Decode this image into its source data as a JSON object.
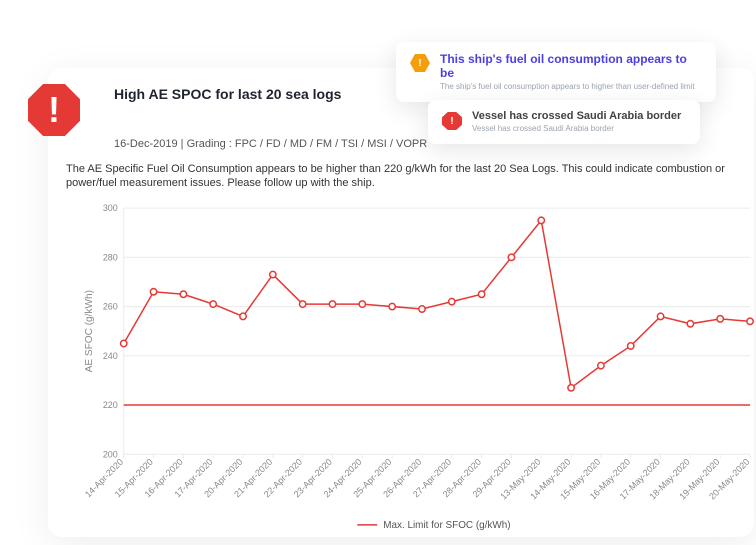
{
  "notifications": [
    {
      "icon": "warning-icon",
      "title": "This ship's fuel oil consumption appears to be",
      "subtitle": "The ship's fuel oil consumption appears to higher than user-defined limit"
    },
    {
      "icon": "alert-icon",
      "title": "Vessel has crossed Saudi Arabia border",
      "subtitle": "Vessel has crossed Saudi Arabia border"
    }
  ],
  "card": {
    "alert_symbol": "!",
    "title": "High AE SPOC for last 20 sea logs",
    "meta": "16-Dec-2019 | Grading : FPC / FD / MD / FM / TSI / MSI / VOPR",
    "description": "The AE Specific Fuel Oil Consumption appears to be higher than 220 g/kWh for the last 20 Sea Logs. This could indicate combustion or power/fuel measurement issues. Please follow up with the ship."
  },
  "chart_data": {
    "type": "line",
    "title": "",
    "xlabel": "",
    "ylabel": "AE SFOC (g/kWh)",
    "ylim": [
      200,
      300
    ],
    "yticks": [
      200,
      220,
      240,
      260,
      280,
      300
    ],
    "categories": [
      "14-Apr-2020",
      "15-Apr-2020",
      "16-Apr-2020",
      "17-Apr-2020",
      "20-Apr-2020",
      "21-Apr-2020",
      "22-Apr-2020",
      "23-Apr-2020",
      "24-Apr-2020",
      "25-Apr-2020",
      "26-Apr-2020",
      "27-Apr-2020",
      "28-Apr-2020",
      "29-Apr-2020",
      "13-May-2020",
      "14-May-2020",
      "15-May-2020",
      "16-May-2020",
      "17-May-2020",
      "18-May-2020",
      "19-May-2020",
      "20-May-2020"
    ],
    "series": [
      {
        "name": "AE SFOC (g/kWh)",
        "values": [
          245,
          266,
          265,
          261,
          256,
          273,
          261,
          261,
          261,
          260,
          259,
          262,
          265,
          280,
          295,
          227,
          236,
          244,
          256,
          253,
          255,
          254
        ]
      }
    ],
    "reference_lines": [
      {
        "name": "Max. Limit for SFOC (g/kWh)",
        "value": 220
      }
    ],
    "legend": "— Max. Limit for SFOC (g/kWh)"
  }
}
